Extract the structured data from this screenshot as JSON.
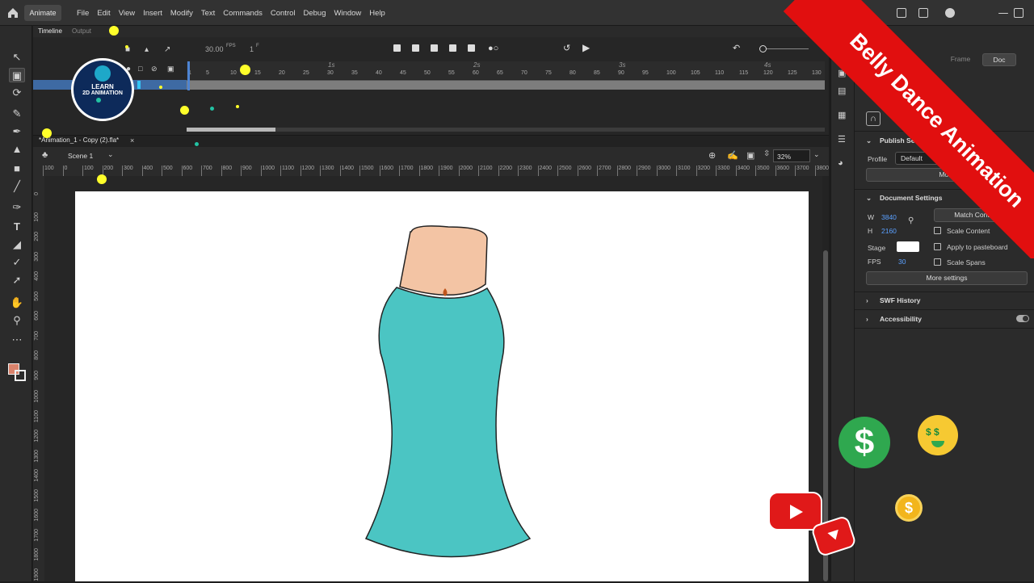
{
  "app": {
    "name": "Animate"
  },
  "menu": [
    "File",
    "Edit",
    "View",
    "Insert",
    "Modify",
    "Text",
    "Commands",
    "Control",
    "Debug",
    "Window",
    "Help"
  ],
  "timeline": {
    "tabs": [
      "Timeline",
      "Output"
    ],
    "fps": "30.00",
    "fps_unit": "FPS",
    "frame": "1",
    "frame_unit": "F",
    "seconds": [
      "1s",
      "2s",
      "3s",
      "4s"
    ],
    "frames": [
      "1",
      "5",
      "10",
      "15",
      "20",
      "25",
      "30",
      "35",
      "40",
      "45",
      "50",
      "55",
      "60",
      "65",
      "70",
      "75",
      "80",
      "85",
      "90",
      "95",
      "100",
      "105",
      "110",
      "115",
      "120",
      "125",
      "130"
    ]
  },
  "document": {
    "tab": "*Animation_1 - Copy (2).fla*",
    "scene": "Scene 1",
    "zoom": "32%"
  },
  "rulers": {
    "h": [
      "100",
      "0",
      "100",
      "200",
      "300",
      "400",
      "500",
      "600",
      "700",
      "800",
      "900",
      "1000",
      "1100",
      "1200",
      "1300",
      "1400",
      "1500",
      "1600",
      "1700",
      "1800",
      "1900",
      "2000",
      "2100",
      "2200",
      "2300",
      "2400",
      "2500",
      "2600",
      "2700",
      "2800",
      "2900",
      "3000",
      "3100",
      "3200",
      "3300",
      "3400",
      "3500",
      "3600",
      "3700",
      "3800"
    ],
    "v": [
      "0",
      "100",
      "200",
      "300",
      "400",
      "500",
      "600",
      "700",
      "800",
      "900",
      "1000",
      "1100",
      "1200",
      "1300",
      "1400",
      "1500",
      "1600",
      "1700",
      "1800",
      "1900"
    ]
  },
  "properties": {
    "tabs": [
      "Frame",
      "Doc"
    ],
    "publish_settings": "Publish Settings",
    "profile_label": "Profile",
    "profile_value": "Default",
    "more_button": "More",
    "document_settings": "Document Settings",
    "w_label": "W",
    "w_value": "3840",
    "h_label": "H",
    "h_value": "2160",
    "match_button": "Match Contents",
    "stage_label": "Stage",
    "fps_label": "FPS",
    "fps_value": "30",
    "scale_content": "Scale Content",
    "apply_pasteboard": "Apply to pasteboard",
    "scale_spans": "Scale Spans",
    "more_settings": "More settings",
    "swf_history": "SWF History",
    "accessibility": "Accessibility"
  },
  "logo": {
    "line1": "LEARN",
    "line2": "2D ANIMATION"
  },
  "banner": "Belly Dance Animation",
  "colors": {
    "stage": "#ffffff",
    "dress": "#4bc5c3",
    "skin": "#f3c4a4",
    "banner": "#e10f0f",
    "fill_swatch": "#d9826b"
  }
}
